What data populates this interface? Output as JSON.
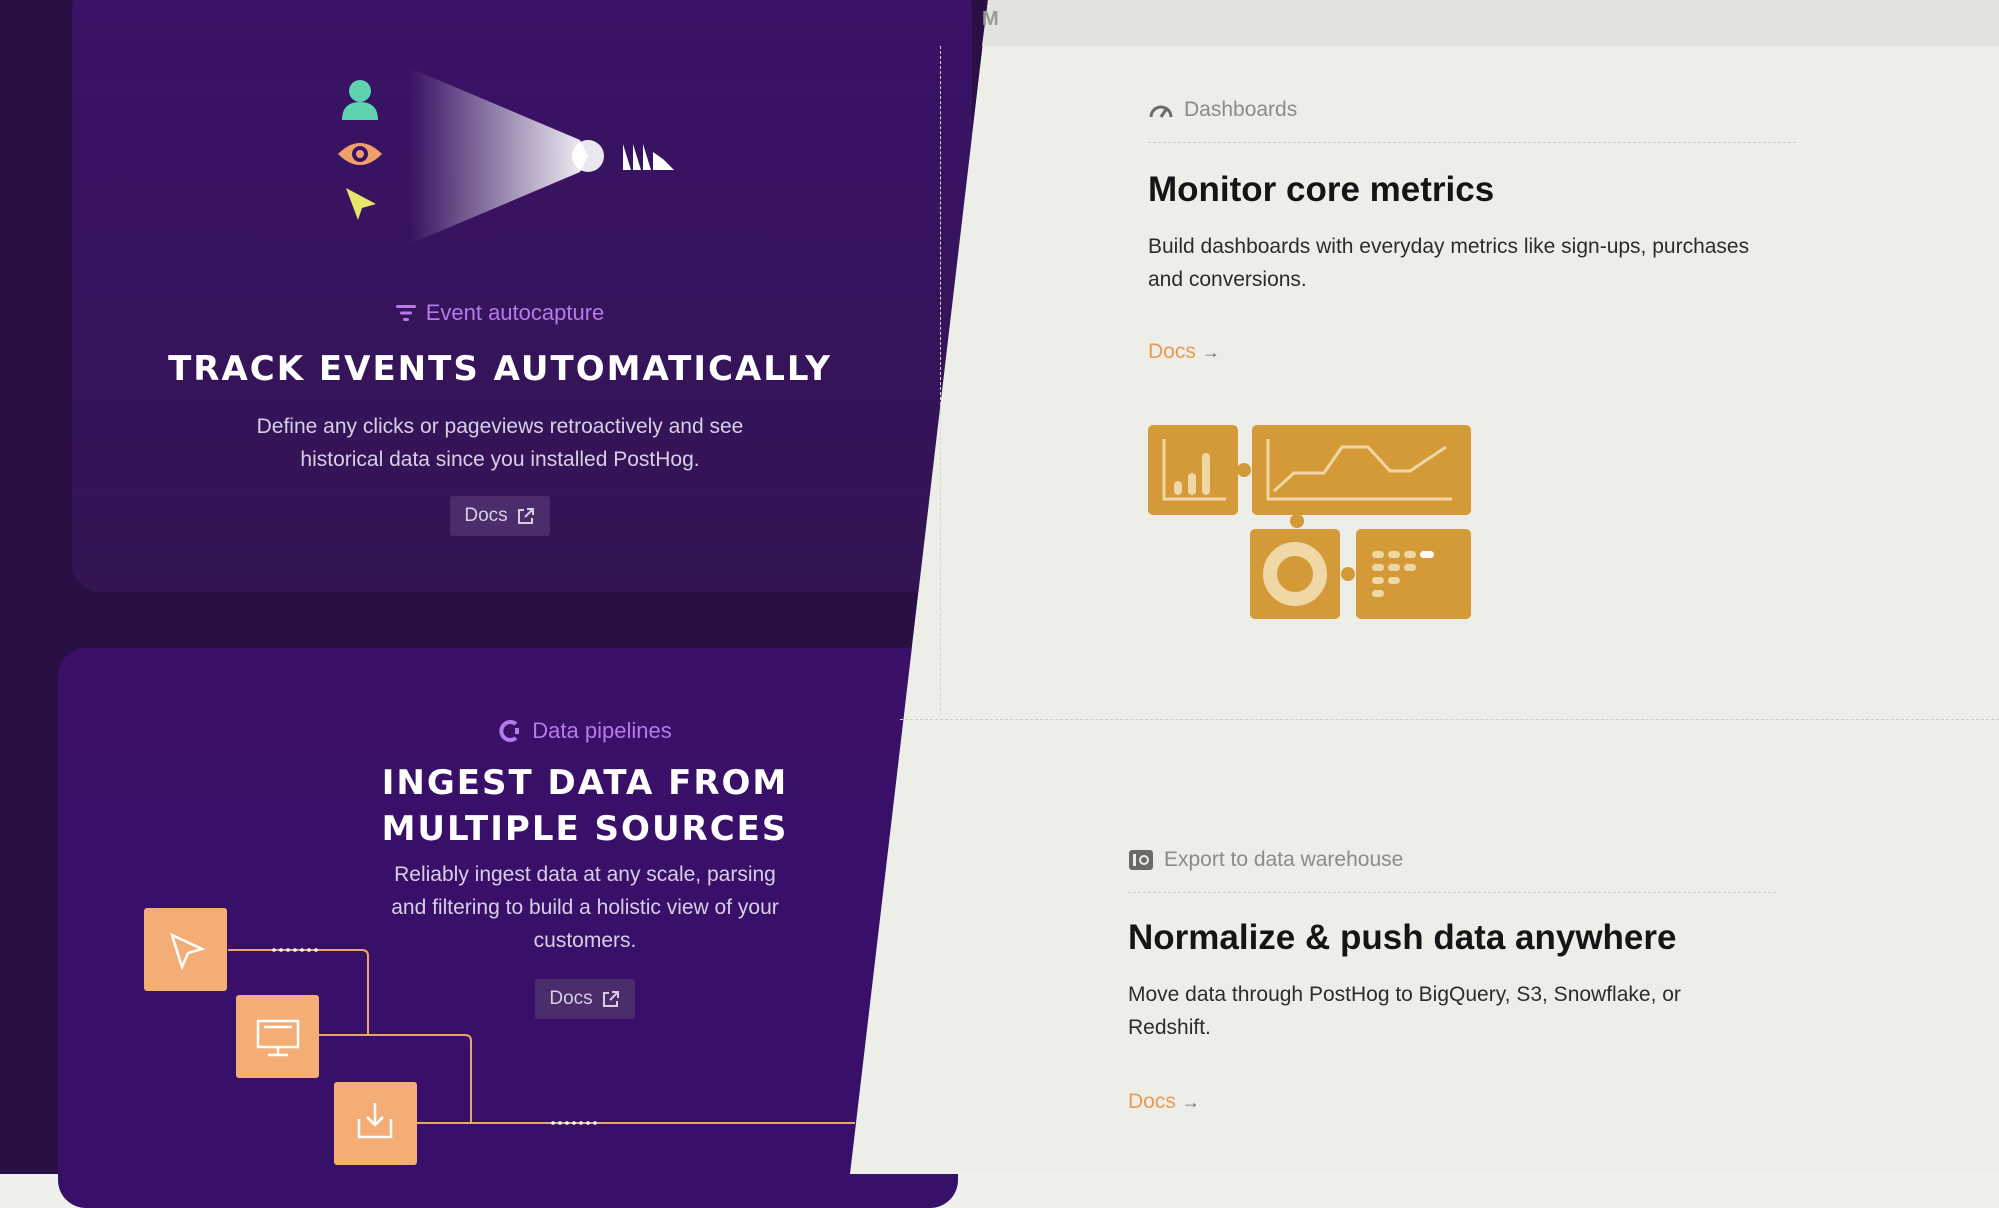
{
  "topbar": {
    "text": "M"
  },
  "autocapture": {
    "tag": "Event autocapture",
    "title": "TRACK EVENTS AUTOMATICALLY",
    "description_line1": "Define any clicks or pageviews retroactively and see",
    "description_line2": "historical data since you installed PostHog.",
    "docs_label": "Docs"
  },
  "pipelines": {
    "tag": "Data pipelines",
    "title_line1": "INGEST DATA FROM",
    "title_line2": "MULTIPLE SOURCES",
    "description_line1": "Reliably ingest data at any scale, parsing",
    "description_line2": "and filtering to build a holistic view of your",
    "description_line3": "customers.",
    "docs_label": "Docs"
  },
  "dashboards": {
    "tag": "Dashboards",
    "title": "Monitor core metrics",
    "description_line1": "Build dashboards with everyday metrics like sign-ups, purchases",
    "description_line2": "and conversions.",
    "docs_label": "Docs",
    "arrow": "→"
  },
  "export": {
    "tag": "Export to data warehouse",
    "title": "Normalize & push data anywhere",
    "description_line1": "Move data through PostHog to BigQuery, S3, Snowflake, or",
    "description_line2": "Redshift.",
    "docs_label": "Docs",
    "arrow": "→"
  },
  "colors": {
    "accent_orange": "#eb9a54",
    "card_purple": "#3a1268",
    "tag_purple": "#b57be8",
    "illustration_gold": "#d39a37",
    "pipeline_orange": "#f5ad76"
  }
}
